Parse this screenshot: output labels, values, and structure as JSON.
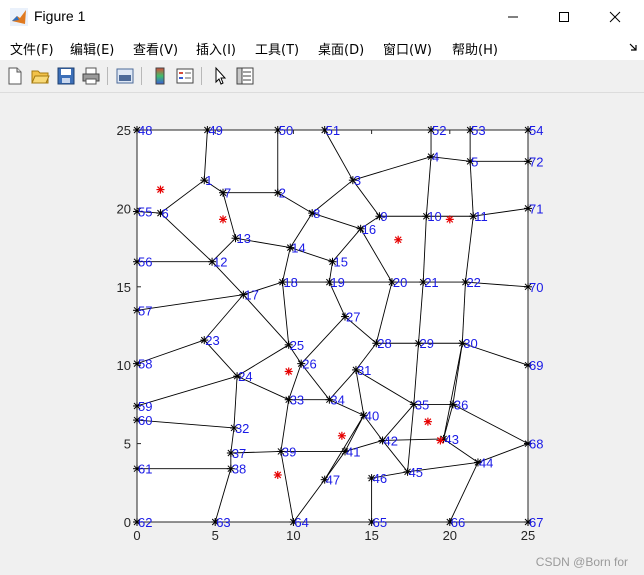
{
  "window": {
    "title": "Figure 1",
    "icons": [
      "matlab-logo-icon",
      "minimize-icon",
      "maximize-icon",
      "close-icon"
    ]
  },
  "menu": {
    "items": [
      {
        "label": "文件(F)"
      },
      {
        "label": "编辑(E)"
      },
      {
        "label": "查看(V)"
      },
      {
        "label": "插入(I)"
      },
      {
        "label": "工具(T)"
      },
      {
        "label": "桌面(D)"
      },
      {
        "label": "窗口(W)"
      },
      {
        "label": "帮助(H)"
      }
    ],
    "dock_icon": "dock-arrow-icon"
  },
  "toolbar": {
    "buttons": [
      "new-figure-icon",
      "open-icon",
      "save-icon",
      "print-icon",
      "link-plot-icon",
      "colorbar-icon",
      "legend-icon",
      "pointer-icon",
      "property-editor-icon"
    ]
  },
  "colors": {
    "node_label": "#1a1ae6",
    "red_marker": "#e60000",
    "line": "#000000"
  },
  "chart_data": {
    "type": "scatter",
    "xlim": [
      0,
      25
    ],
    "ylim": [
      0,
      25
    ],
    "xticks": [
      "0",
      "5",
      "10",
      "15",
      "20",
      "25"
    ],
    "yticks": [
      "0",
      "5",
      "10",
      "15",
      "20",
      "25"
    ],
    "grid": false,
    "nodes": [
      {
        "id": 1,
        "x": 4.3,
        "y": 21.8
      },
      {
        "id": 2,
        "x": 9.0,
        "y": 21.0
      },
      {
        "id": 3,
        "x": 13.8,
        "y": 21.8
      },
      {
        "id": 4,
        "x": 18.8,
        "y": 23.3
      },
      {
        "id": 5,
        "x": 21.3,
        "y": 23.0
      },
      {
        "id": 6,
        "x": 1.5,
        "y": 19.7
      },
      {
        "id": 7,
        "x": 5.5,
        "y": 21.0
      },
      {
        "id": 8,
        "x": 11.2,
        "y": 19.7
      },
      {
        "id": 9,
        "x": 15.5,
        "y": 19.5
      },
      {
        "id": 10,
        "x": 18.5,
        "y": 19.5
      },
      {
        "id": 11,
        "x": 21.5,
        "y": 19.5
      },
      {
        "id": 12,
        "x": 4.8,
        "y": 16.6
      },
      {
        "id": 13,
        "x": 6.3,
        "y": 18.1
      },
      {
        "id": 14,
        "x": 9.8,
        "y": 17.5
      },
      {
        "id": 15,
        "x": 12.5,
        "y": 16.6
      },
      {
        "id": 16,
        "x": 14.3,
        "y": 18.7
      },
      {
        "id": 17,
        "x": 6.8,
        "y": 14.5
      },
      {
        "id": 18,
        "x": 9.3,
        "y": 15.3
      },
      {
        "id": 19,
        "x": 12.3,
        "y": 15.3
      },
      {
        "id": 20,
        "x": 16.3,
        "y": 15.3
      },
      {
        "id": 21,
        "x": 18.3,
        "y": 15.3
      },
      {
        "id": 22,
        "x": 21.0,
        "y": 15.3
      },
      {
        "id": 23,
        "x": 4.3,
        "y": 11.6
      },
      {
        "id": 24,
        "x": 6.4,
        "y": 9.3
      },
      {
        "id": 25,
        "x": 9.7,
        "y": 11.3
      },
      {
        "id": 26,
        "x": 10.5,
        "y": 10.1
      },
      {
        "id": 27,
        "x": 13.3,
        "y": 13.1
      },
      {
        "id": 28,
        "x": 15.3,
        "y": 11.4
      },
      {
        "id": 29,
        "x": 18.0,
        "y": 11.4
      },
      {
        "id": 30,
        "x": 20.8,
        "y": 11.4
      },
      {
        "id": 31,
        "x": 14.0,
        "y": 9.7
      },
      {
        "id": 32,
        "x": 6.2,
        "y": 6.0
      },
      {
        "id": 33,
        "x": 9.7,
        "y": 7.8
      },
      {
        "id": 34,
        "x": 12.3,
        "y": 7.8
      },
      {
        "id": 35,
        "x": 17.7,
        "y": 7.5
      },
      {
        "id": 36,
        "x": 20.2,
        "y": 7.5
      },
      {
        "id": 37,
        "x": 6.0,
        "y": 4.4
      },
      {
        "id": 38,
        "x": 6.0,
        "y": 3.4
      },
      {
        "id": 39,
        "x": 9.2,
        "y": 4.5
      },
      {
        "id": 40,
        "x": 14.5,
        "y": 6.8
      },
      {
        "id": 41,
        "x": 13.3,
        "y": 4.5
      },
      {
        "id": 42,
        "x": 15.7,
        "y": 5.2
      },
      {
        "id": 43,
        "x": 19.6,
        "y": 5.3
      },
      {
        "id": 44,
        "x": 21.8,
        "y": 3.8
      },
      {
        "id": 45,
        "x": 17.3,
        "y": 3.2
      },
      {
        "id": 46,
        "x": 15.0,
        "y": 2.8
      },
      {
        "id": 47,
        "x": 12.0,
        "y": 2.7
      },
      {
        "id": 48,
        "x": 0.0,
        "y": 25.0
      },
      {
        "id": 49,
        "x": 4.5,
        "y": 25.0
      },
      {
        "id": 50,
        "x": 9.0,
        "y": 25.0
      },
      {
        "id": 51,
        "x": 12.0,
        "y": 25.0
      },
      {
        "id": 52,
        "x": 18.8,
        "y": 25.0
      },
      {
        "id": 53,
        "x": 21.3,
        "y": 25.0
      },
      {
        "id": 54,
        "x": 25.0,
        "y": 25.0
      },
      {
        "id": 55,
        "x": 0.0,
        "y": 19.8
      },
      {
        "id": 56,
        "x": 0.0,
        "y": 16.6
      },
      {
        "id": 57,
        "x": 0.0,
        "y": 13.5
      },
      {
        "id": 58,
        "x": 0.0,
        "y": 10.1
      },
      {
        "id": 59,
        "x": 0.0,
        "y": 7.4
      },
      {
        "id": 60,
        "x": 0.0,
        "y": 6.5
      },
      {
        "id": 61,
        "x": 0.0,
        "y": 3.4
      },
      {
        "id": 62,
        "x": 0.0,
        "y": 0.0
      },
      {
        "id": 63,
        "x": 5.0,
        "y": 0.0
      },
      {
        "id": 64,
        "x": 10.0,
        "y": 0.0
      },
      {
        "id": 65,
        "x": 15.0,
        "y": 0.0
      },
      {
        "id": 66,
        "x": 20.0,
        "y": 0.0
      },
      {
        "id": 67,
        "x": 25.0,
        "y": 0.0
      },
      {
        "id": 68,
        "x": 25.0,
        "y": 5.0
      },
      {
        "id": 69,
        "x": 25.0,
        "y": 10.0
      },
      {
        "id": 70,
        "x": 25.0,
        "y": 15.0
      },
      {
        "id": 71,
        "x": 25.0,
        "y": 20.0
      },
      {
        "id": 72,
        "x": 25.0,
        "y": 23.0
      }
    ],
    "edges": [
      [
        62,
        63
      ],
      [
        63,
        64
      ],
      [
        64,
        65
      ],
      [
        65,
        66
      ],
      [
        66,
        67
      ],
      [
        67,
        68
      ],
      [
        68,
        69
      ],
      [
        69,
        70
      ],
      [
        70,
        71
      ],
      [
        71,
        72
      ],
      [
        72,
        54
      ],
      [
        54,
        53
      ],
      [
        53,
        52
      ],
      [
        52,
        51
      ],
      [
        51,
        50
      ],
      [
        50,
        49
      ],
      [
        49,
        48
      ],
      [
        48,
        55
      ],
      [
        55,
        56
      ],
      [
        56,
        57
      ],
      [
        57,
        58
      ],
      [
        58,
        59
      ],
      [
        59,
        60
      ],
      [
        60,
        61
      ],
      [
        61,
        62
      ],
      [
        49,
        1
      ],
      [
        1,
        6
      ],
      [
        1,
        7
      ],
      [
        7,
        2
      ],
      [
        2,
        50
      ],
      [
        2,
        8
      ],
      [
        7,
        13
      ],
      [
        13,
        12
      ],
      [
        12,
        6
      ],
      [
        6,
        55
      ],
      [
        12,
        56
      ],
      [
        12,
        17
      ],
      [
        17,
        57
      ],
      [
        51,
        3
      ],
      [
        3,
        8
      ],
      [
        3,
        4
      ],
      [
        4,
        5
      ],
      [
        5,
        72
      ],
      [
        4,
        52
      ],
      [
        5,
        53
      ],
      [
        3,
        9
      ],
      [
        9,
        10
      ],
      [
        10,
        11
      ],
      [
        11,
        71
      ],
      [
        10,
        4
      ],
      [
        11,
        5
      ],
      [
        8,
        14
      ],
      [
        8,
        16
      ],
      [
        16,
        9
      ],
      [
        16,
        15
      ],
      [
        16,
        20
      ],
      [
        13,
        14
      ],
      [
        14,
        15
      ],
      [
        14,
        18
      ],
      [
        18,
        17
      ],
      [
        18,
        19
      ],
      [
        19,
        15
      ],
      [
        19,
        27
      ],
      [
        19,
        20
      ],
      [
        20,
        21
      ],
      [
        21,
        22
      ],
      [
        22,
        70
      ],
      [
        21,
        10
      ],
      [
        22,
        11
      ],
      [
        21,
        29
      ],
      [
        22,
        30
      ],
      [
        30,
        69
      ],
      [
        27,
        28
      ],
      [
        28,
        20
      ],
      [
        28,
        29
      ],
      [
        29,
        30
      ],
      [
        17,
        25
      ],
      [
        18,
        25
      ],
      [
        25,
        26
      ],
      [
        26,
        27
      ],
      [
        26,
        34
      ],
      [
        17,
        23
      ],
      [
        23,
        58
      ],
      [
        23,
        24
      ],
      [
        24,
        25
      ],
      [
        24,
        59
      ],
      [
        24,
        32
      ],
      [
        32,
        60
      ],
      [
        32,
        37
      ],
      [
        37,
        38
      ],
      [
        38,
        61
      ],
      [
        38,
        63
      ],
      [
        24,
        33
      ],
      [
        33,
        34
      ],
      [
        34,
        31
      ],
      [
        31,
        28
      ],
      [
        31,
        35
      ],
      [
        35,
        29
      ],
      [
        35,
        36
      ],
      [
        36,
        30
      ],
      [
        36,
        68
      ],
      [
        35,
        42
      ],
      [
        33,
        39
      ],
      [
        39,
        37
      ],
      [
        39,
        64
      ],
      [
        39,
        41
      ],
      [
        34,
        40
      ],
      [
        40,
        41
      ],
      [
        41,
        42
      ],
      [
        42,
        43
      ],
      [
        43,
        36
      ],
      [
        43,
        44
      ],
      [
        44,
        68
      ],
      [
        44,
        66
      ],
      [
        42,
        45
      ],
      [
        45,
        44
      ],
      [
        45,
        35
      ],
      [
        41,
        47
      ],
      [
        47,
        64
      ],
      [
        40,
        47
      ],
      [
        46,
        45
      ],
      [
        46,
        65
      ],
      [
        40,
        42
      ],
      [
        30,
        43
      ],
      [
        26,
        33
      ],
      [
        31,
        40
      ]
    ],
    "red_markers": [
      {
        "x": 1.5,
        "y": 21.2
      },
      {
        "x": 5.5,
        "y": 19.3
      },
      {
        "x": 16.7,
        "y": 18.0
      },
      {
        "x": 20.0,
        "y": 19.3
      },
      {
        "x": 9.7,
        "y": 9.6
      },
      {
        "x": 13.1,
        "y": 5.5
      },
      {
        "x": 18.6,
        "y": 6.4
      },
      {
        "x": 19.4,
        "y": 5.2
      },
      {
        "x": 9.0,
        "y": 3.0
      }
    ]
  },
  "watermark": "CSDN @Born for"
}
